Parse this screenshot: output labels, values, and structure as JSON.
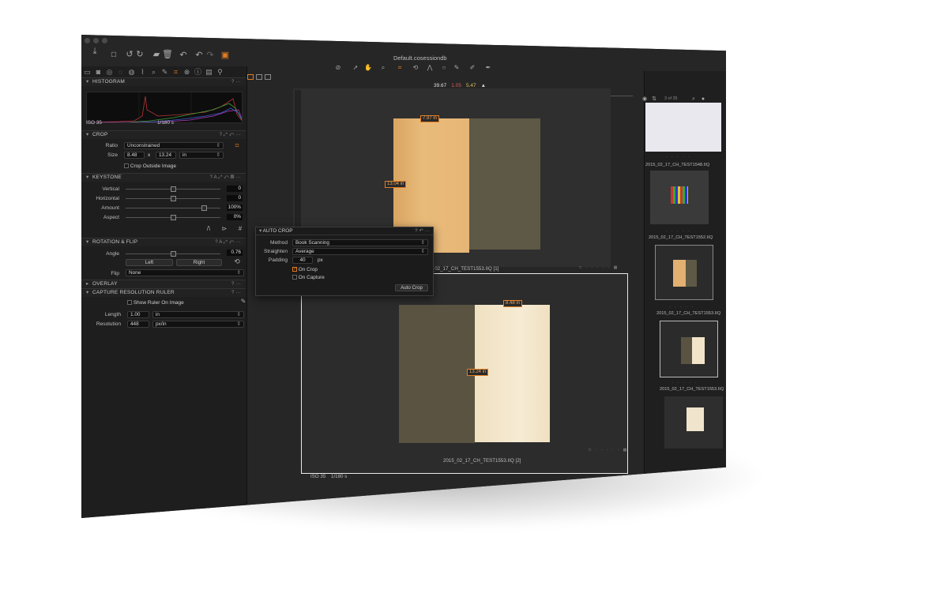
{
  "window": {
    "title": "Default.cosessiondb"
  },
  "left_tabs": [
    "folder-icon",
    "camera-icon",
    "lens-icon",
    "layers-icon",
    "details-icon",
    "exposure-icon",
    "focus-icon",
    "color-icon",
    "crop-icon",
    "adjustments-icon",
    "metadata-icon",
    "output-icon",
    "batch-icon"
  ],
  "histogram": {
    "title": "HISTOGRAM",
    "iso": "ISO 35",
    "shutter": "1/180 s"
  },
  "crop": {
    "title": "CROP",
    "ratio_label": "Ratio",
    "ratio_value": "Unconstrained",
    "size_label": "Size",
    "width": "8.48",
    "x": "x",
    "height": "13.24",
    "unit": "in",
    "outside_label": "Crop Outside Image"
  },
  "keystone": {
    "title": "KEYSTONE",
    "rows": [
      {
        "label": "Vertical",
        "value": "0",
        "pos": 0.5
      },
      {
        "label": "Horizontal",
        "value": "0",
        "pos": 0.5
      },
      {
        "label": "Amount",
        "value": "100%",
        "pos": 0.83
      },
      {
        "label": "Aspect",
        "value": "0%",
        "pos": 0.5
      }
    ]
  },
  "rotation": {
    "title": "ROTATION & FLIP",
    "angle_label": "Angle",
    "angle_value": "0.76",
    "left_button": "Left",
    "right_button": "Right",
    "flip_label": "Flip",
    "flip_value": "None"
  },
  "overlay": {
    "title": "OVERLAY"
  },
  "ruler": {
    "title": "CAPTURE RESOLUTION RULER",
    "show_label": "Show Ruler On Image",
    "length_label": "Length",
    "length_value": "1.00",
    "length_unit": "in",
    "resolution_label": "Resolution",
    "resolution_value": "448",
    "resolution_unit": "px/in"
  },
  "readout": {
    "r": "39.67",
    "g": "1.05",
    "b": "5.47"
  },
  "viewer": {
    "top_image": {
      "caption": "2015_02_17_CH_TEST1553.IIQ [1]",
      "width_tag": "7.97 in",
      "height_tag": "13.04 in"
    },
    "bottom_image": {
      "caption": "2015_02_17_CH_TEST1553.IIQ [2]",
      "width_tag": "8.48 in",
      "height_tag": "13.24 in"
    },
    "status_iso": "ISO 35",
    "status_shutter": "1/180 s",
    "zoom": "8%"
  },
  "autocrop": {
    "title": "AUTO CROP",
    "method_label": "Method",
    "method_value": "Book Scanning",
    "straighten_label": "Straighten",
    "straighten_value": "Average",
    "padding_label": "Padding",
    "padding_value": "40",
    "padding_unit": "px",
    "on_crop_label": "On Crop",
    "on_capture_label": "On Capture",
    "button": "Auto Crop"
  },
  "filmstrip": {
    "counter": "3 of 35",
    "thumbs": [
      {
        "caption": "2015_02_17_CH_TEST1548.IIQ"
      },
      {
        "caption": "2015_02_17_CH_TEST1552.IIQ"
      },
      {
        "caption": "2015_02_17_CH_TEST1553.IIQ"
      },
      {
        "caption": "2015_02_17_CH_TEST1553.IIQ"
      }
    ]
  },
  "colors": {
    "accent": "#e27d22",
    "bg": "#1c1c1c",
    "panel": "#1e1e1e"
  }
}
